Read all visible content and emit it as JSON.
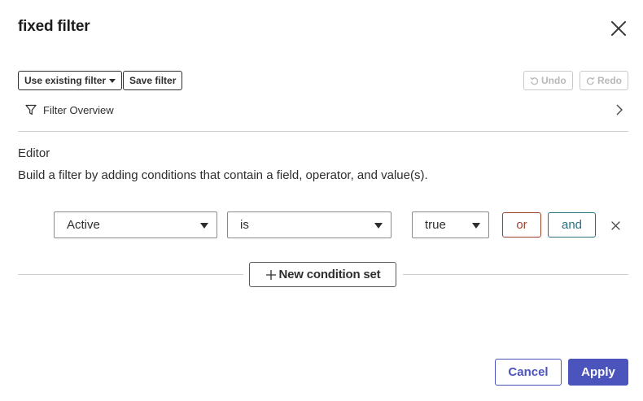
{
  "dialog": {
    "title": "fixed filter",
    "close_icon": "close-icon"
  },
  "toolbar": {
    "use_existing_label": "Use existing filter",
    "save_filter_label": "Save filter",
    "undo_label": "Undo",
    "redo_label": "Redo",
    "undo_enabled": false,
    "redo_enabled": false
  },
  "overview": {
    "label": "Filter Overview",
    "icon": "funnel-icon",
    "chevron": "chevron-right-icon"
  },
  "editor": {
    "title": "Editor",
    "description": "Build a filter by adding conditions that contain a field, operator, and value(s)."
  },
  "condition": {
    "field": "Active",
    "operator": "is",
    "value": "true",
    "or_label": "or",
    "and_label": "and"
  },
  "new_condition_set_label": "New condition set",
  "footer": {
    "cancel_label": "Cancel",
    "apply_label": "Apply"
  },
  "colors": {
    "primary": "#4b53bc",
    "or_border": "#a0412d",
    "and_border": "#2a6f7d",
    "text": "#2e2e2e",
    "disabled": "#b8b8b8"
  }
}
